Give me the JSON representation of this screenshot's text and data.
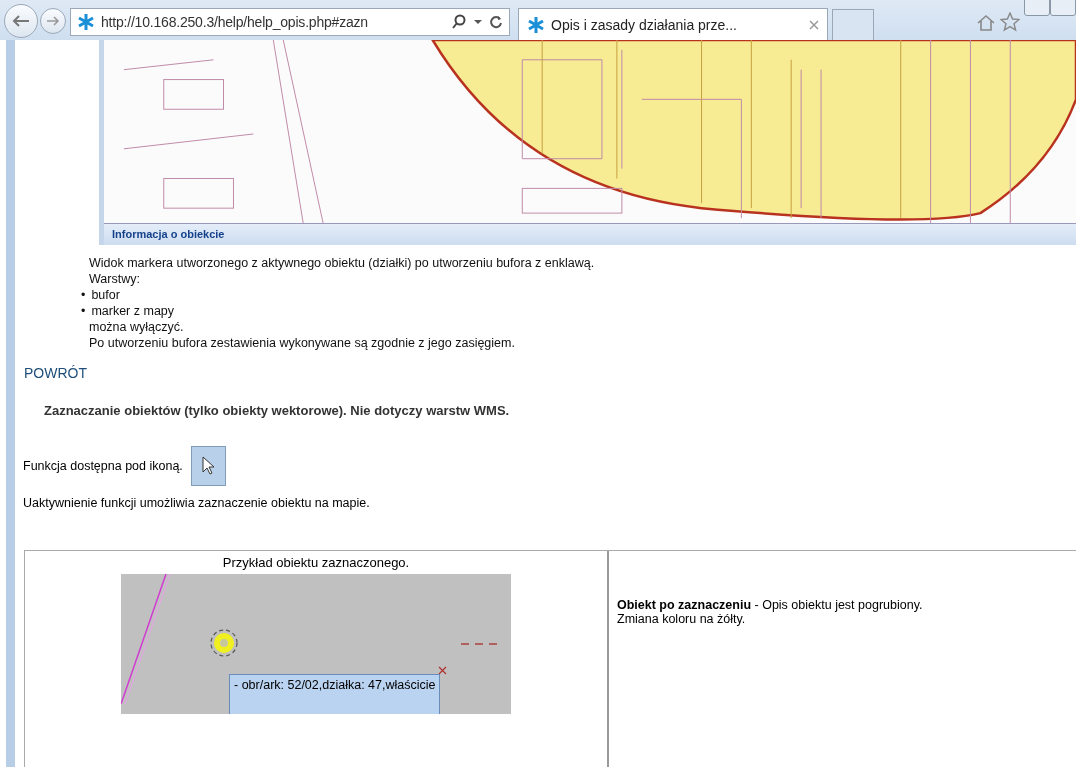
{
  "browser": {
    "address": "http://10.168.250.3/help/help_opis.php#zazn",
    "tab": {
      "title": "Opis i zasady działania prze...",
      "selected": true
    }
  },
  "map_screenshot": {
    "panel_title": "Informacja o obiekcie"
  },
  "intro": {
    "lines": [
      "Widok markera utworzonego z aktywnego obiektu (działki) po utworzeniu bufora z enklawą.",
      "Warstwy:"
    ],
    "bullets": [
      {
        "marker": "•",
        "text": "bufor"
      },
      {
        "marker": "•",
        "text": "marker z mapy"
      }
    ],
    "after": [
      "można wyłączyć.",
      "Po utworzeniu bufora zestawienia wykonywane są zgodnie z jego zasięgiem."
    ]
  },
  "back_link": "POWRÓT",
  "section_title": "Zaznaczanie obiektów (tylko obiekty wektorowe). Nie dotyczy warstw WMS.",
  "function_text": "Funkcja dostępna pod ikoną.",
  "activation_text": "Uaktywnienie funkcji umożliwia zaznaczenie obiektu na mapie.",
  "example": {
    "caption": "Przykład obiektu zaznaczonego.",
    "tooltip": "- obr/ark: 52/02,działka: 47,właścicie",
    "description": "**Obiekt po zaznaczeniu** - Opis obiektu jest pogrubiony. Zmiana koloru na żółty."
  }
}
